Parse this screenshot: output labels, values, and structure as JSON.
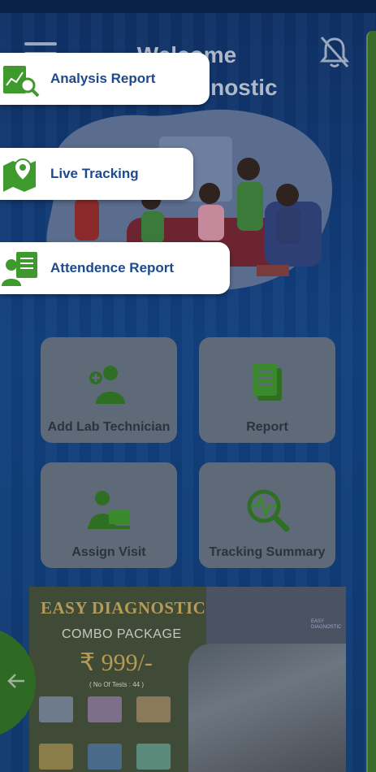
{
  "header": {
    "title_line1": "Welcome",
    "title_line2": "Diagnostic"
  },
  "popup_menu": [
    {
      "label": "Analysis Report",
      "icon": "analysis-report-icon"
    },
    {
      "label": "Live Tracking",
      "icon": "map-pin-icon"
    },
    {
      "label": "Attendence Report",
      "icon": "attendance-report-icon"
    }
  ],
  "tiles": [
    {
      "label": "Add Lab Technician",
      "icon": "add-technician-icon"
    },
    {
      "label": "Report",
      "icon": "report-icon"
    },
    {
      "label": "Assign Visit",
      "icon": "assign-visit-icon"
    },
    {
      "label": "Tracking Summary",
      "icon": "tracking-summary-icon"
    }
  ],
  "banner": {
    "title": "EASY DIAGNOSTIC",
    "subtitle": "COMBO PACKAGE",
    "price": "₹ 999/-",
    "tests": "( No Of Tests : 44 )",
    "brand_line1": "EASY",
    "brand_line2": "DIAGNOSTIC"
  },
  "colors": {
    "accent_green": "#3f9a2e",
    "label_blue": "#1d4a8c",
    "background": "#12407f"
  }
}
